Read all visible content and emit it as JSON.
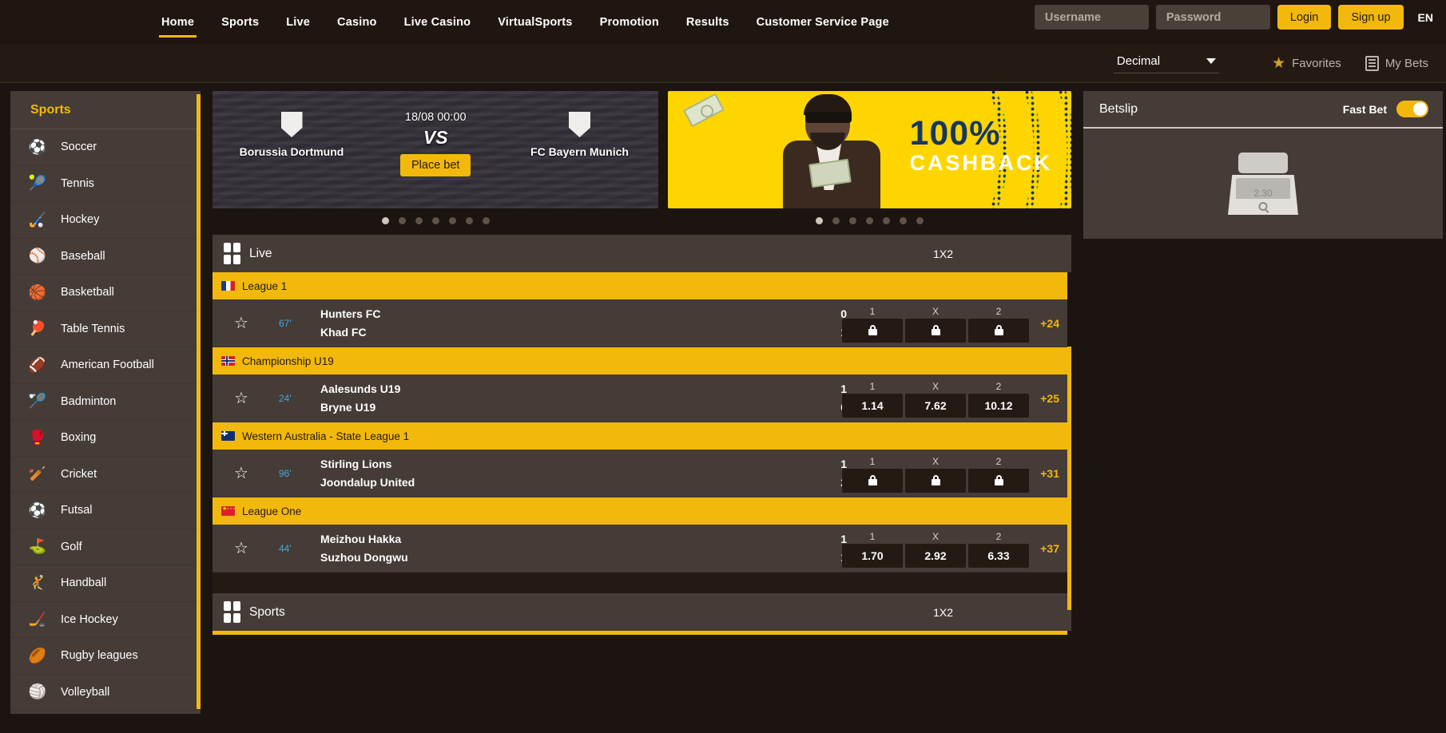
{
  "nav": {
    "items": [
      {
        "label": "Home",
        "active": true
      },
      {
        "label": "Sports",
        "active": false
      },
      {
        "label": "Live",
        "active": false
      },
      {
        "label": "Casino",
        "active": false
      },
      {
        "label": "Live Casino",
        "active": false
      },
      {
        "label": "VirtualSports",
        "active": false
      },
      {
        "label": "Promotion",
        "active": false
      },
      {
        "label": "Results",
        "active": false
      },
      {
        "label": "Customer Service Page",
        "active": false
      }
    ]
  },
  "auth": {
    "username_placeholder": "Username",
    "password_placeholder": "Password",
    "username_value": "",
    "password_value": "",
    "login_label": "Login",
    "signup_label": "Sign up",
    "language": "EN"
  },
  "subbar": {
    "odds_format": "Decimal",
    "favorites_label": "Favorites",
    "mybets_label": "My Bets"
  },
  "sidebar": {
    "title": "Sports",
    "items": [
      {
        "label": "Soccer",
        "icon": "soccer-ball-icon",
        "glyph": "⚽"
      },
      {
        "label": "Tennis",
        "icon": "tennis-ball-icon",
        "glyph": "🎾"
      },
      {
        "label": "Hockey",
        "icon": "hockey-stick-icon",
        "glyph": "🏑"
      },
      {
        "label": "Baseball",
        "icon": "baseball-icon",
        "glyph": "⚾"
      },
      {
        "label": "Basketball",
        "icon": "basketball-icon",
        "glyph": "🏀"
      },
      {
        "label": "Table Tennis",
        "icon": "table-tennis-paddle-icon",
        "glyph": "🏓"
      },
      {
        "label": "American Football",
        "icon": "american-football-icon",
        "glyph": "🏈"
      },
      {
        "label": "Badminton",
        "icon": "badminton-racket-icon",
        "glyph": "🏸"
      },
      {
        "label": "Boxing",
        "icon": "boxing-glove-icon",
        "glyph": "🥊"
      },
      {
        "label": "Cricket",
        "icon": "cricket-wicket-icon",
        "glyph": "🏏"
      },
      {
        "label": "Futsal",
        "icon": "futsal-player-icon",
        "glyph": "⚽"
      },
      {
        "label": "Golf",
        "icon": "golf-club-icon",
        "glyph": "⛳"
      },
      {
        "label": "Handball",
        "icon": "handball-player-icon",
        "glyph": "🤾"
      },
      {
        "label": "Ice Hockey",
        "icon": "hockey-puck-icon",
        "glyph": "🏒"
      },
      {
        "label": "Rugby leagues",
        "icon": "rugby-ball-icon",
        "glyph": "🏉"
      },
      {
        "label": "Volleyball",
        "icon": "volleyball-icon",
        "glyph": "🏐"
      }
    ]
  },
  "banners": {
    "match": {
      "home_team": "Borussia Dortmund",
      "away_team": "FC Bayern Munich",
      "kickoff": "18/08 00:00",
      "vs_label": "VS",
      "cta_label": "Place bet",
      "dots_total": 7,
      "dots_active": 1
    },
    "promo": {
      "headline": "100%",
      "subhead": "CASHBACK",
      "dots_total": 7,
      "dots_active": 1
    }
  },
  "live_section": {
    "title": "Live",
    "market": "1X2",
    "leagues": [
      {
        "name": "League 1",
        "flag": "flag-fr",
        "matches": [
          {
            "minute": "67'",
            "home": "Hunters FC",
            "away": "Khad FC",
            "home_score": "0",
            "away_score": "1",
            "locked": true,
            "odds": [
              {
                "key": "1",
                "value": ""
              },
              {
                "key": "X",
                "value": ""
              },
              {
                "key": "2",
                "value": ""
              }
            ],
            "more": "+24"
          }
        ]
      },
      {
        "name": "Championship U19",
        "flag": "flag-no",
        "matches": [
          {
            "minute": "24'",
            "home": "Aalesunds U19",
            "away": "Bryne U19",
            "home_score": "1",
            "away_score": "0",
            "locked": false,
            "odds": [
              {
                "key": "1",
                "value": "1.14"
              },
              {
                "key": "X",
                "value": "7.62"
              },
              {
                "key": "2",
                "value": "10.12"
              }
            ],
            "more": "+25"
          }
        ]
      },
      {
        "name": "Western Australia - State League 1",
        "flag": "flag-au",
        "matches": [
          {
            "minute": "96'",
            "home": "Stirling Lions",
            "away": "Joondalup United",
            "home_score": "1",
            "away_score": "2",
            "locked": true,
            "odds": [
              {
                "key": "1",
                "value": ""
              },
              {
                "key": "X",
                "value": ""
              },
              {
                "key": "2",
                "value": ""
              }
            ],
            "more": "+31"
          }
        ]
      },
      {
        "name": "League One",
        "flag": "flag-cn",
        "matches": [
          {
            "minute": "44'",
            "home": "Meizhou Hakka",
            "away": "Suzhou Dongwu",
            "home_score": "1",
            "away_score": "1",
            "locked": false,
            "odds": [
              {
                "key": "1",
                "value": "1.70"
              },
              {
                "key": "X",
                "value": "2.92"
              },
              {
                "key": "2",
                "value": "6.33"
              }
            ],
            "more": "+37"
          }
        ]
      }
    ]
  },
  "sports_section": {
    "title": "Sports",
    "market": "1X2"
  },
  "betslip": {
    "title": "Betslip",
    "fast_bet_label": "Fast Bet",
    "fast_bet_on": true,
    "empty_odds": "2.30"
  },
  "colors": {
    "accent_gold": "#f2b90c",
    "panel": "#453c38",
    "page_bg": "#1c1410",
    "odds_bg": "#241a14",
    "time_blue": "#4aa3d6",
    "promo_yellow": "#ffd500",
    "promo_navy": "#17375e"
  }
}
